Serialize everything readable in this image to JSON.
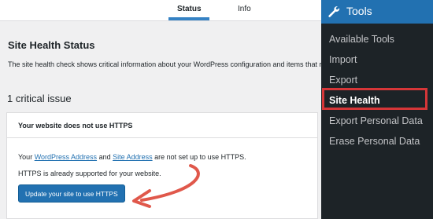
{
  "tabs": [
    {
      "label": "Status"
    },
    {
      "label": "Info"
    }
  ],
  "page": {
    "title": "Site Health Status",
    "description": "The site health check shows critical information about your WordPress configuration and items that r",
    "issues_count_label": "1 critical issue"
  },
  "issue": {
    "title": "Your website does not use HTTPS",
    "text_prefix": "Your ",
    "link_wp_address": "WordPress Address",
    "text_and": " and ",
    "link_site_address": "Site Address",
    "text_suffix": " are not set up to use HTTPS.",
    "supported_text": "HTTPS is already supported for your website.",
    "button_label": "Update your site to use HTTPS"
  },
  "admin_menu": {
    "header_label": "Tools",
    "header_icon": "wrench-icon",
    "items": [
      {
        "label": "Available Tools"
      },
      {
        "label": "Import"
      },
      {
        "label": "Export"
      },
      {
        "label": "Site Health"
      },
      {
        "label": "Export Personal Data"
      },
      {
        "label": "Erase Personal Data"
      }
    ]
  },
  "colors": {
    "accent": "#2271b1",
    "highlight": "#d63638",
    "menu_bg": "#1d2327",
    "arrow": "#e0584b"
  }
}
